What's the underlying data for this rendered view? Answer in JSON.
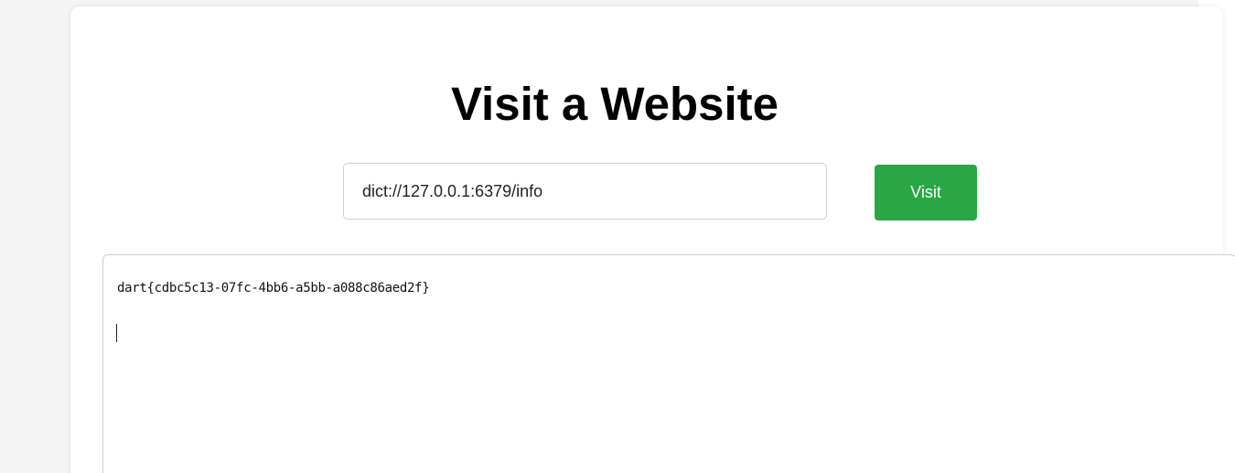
{
  "page": {
    "title": "Visit a Website"
  },
  "form": {
    "url_value": "dict://127.0.0.1:6379/info",
    "visit_label": "Visit"
  },
  "output": {
    "text": "dart{cdbc5c13-07fc-4bb6-a5bb-a088c86aed2f}"
  },
  "colors": {
    "accent": "#29a745",
    "background": "#f4f4f4",
    "card": "#ffffff"
  }
}
